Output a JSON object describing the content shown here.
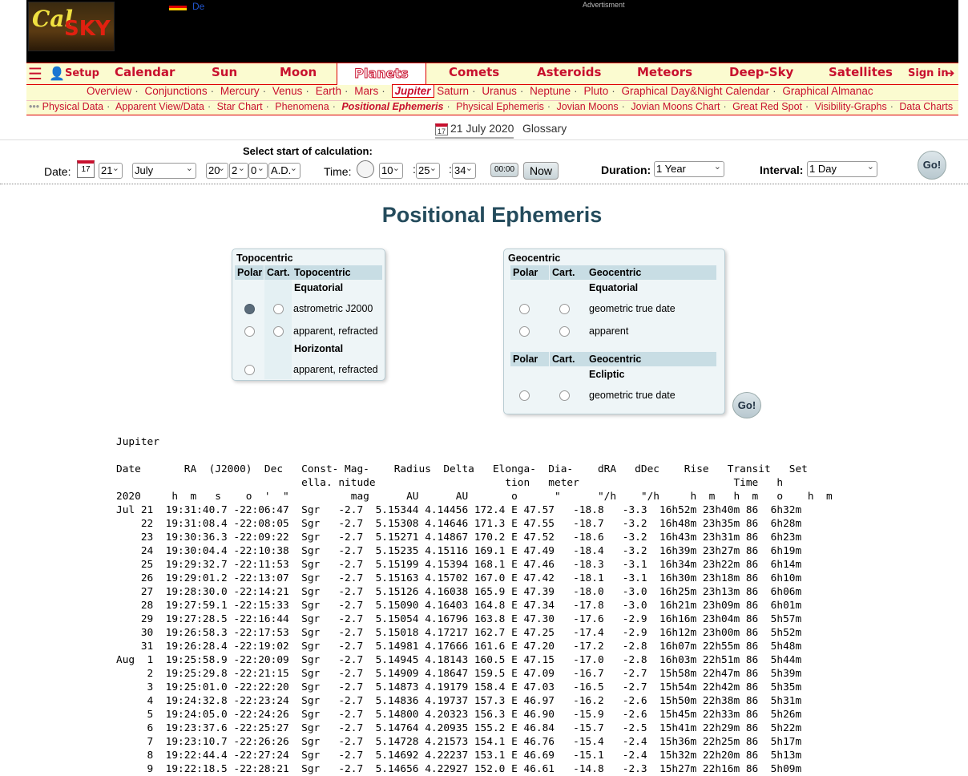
{
  "header": {
    "logo_text": [
      "Cal",
      "SKY"
    ],
    "lang": "De",
    "advertisement": "Advertisment"
  },
  "mainnav": {
    "setup": "Setup",
    "items": [
      "Calendar",
      "Sun",
      "Moon",
      "Planets",
      "Comets",
      "Asteroids",
      "Meteors",
      "Deep-Sky",
      "Satellites"
    ],
    "signin": "Sign in"
  },
  "subnav1": [
    "Overview",
    "Conjunctions",
    "Mercury",
    "Venus",
    "Earth",
    "Mars",
    "Jupiter",
    "Saturn",
    "Uranus",
    "Neptune",
    "Pluto",
    "Graphical Day&Night Calendar",
    "Graphical Almanac"
  ],
  "subnav2": [
    "Physical Data",
    "Apparent View/Data",
    "Star Chart",
    "Phenomena",
    "Positional Ephemeris",
    "Physical Ephemeris",
    "Jovian Moons",
    "Jovian Moons Chart",
    "Great Red Spot",
    "Visibility-Graphs",
    "Data Charts"
  ],
  "dateline": {
    "date": "21 July 2020",
    "glossary": "Glossary",
    "cal_icon_text": "17"
  },
  "form": {
    "heading": "Select start of calculation:",
    "date_label": "Date:",
    "day": "21",
    "month": "July",
    "century": "20",
    "decade": "2",
    "year_digit": "0",
    "era": "A.D.",
    "time_label": "Time:",
    "hour": "10",
    "minute": "25",
    "second": "34",
    "zero_btn": "00:00",
    "now_btn": "Now",
    "duration_label": "Duration:",
    "duration": "1 Year",
    "interval_label": "Interval:",
    "interval": "1 Day",
    "go": "Go!"
  },
  "page_title": "Positional Ephemeris",
  "topocentric": {
    "title": "Topocentric",
    "col_polar": "Polar",
    "col_cart": "Cart.",
    "col_head": "Topocentric",
    "sub1": "Equatorial",
    "opt1": "astrometric J2000",
    "opt2": "apparent, refracted",
    "sub2": "Horizontal",
    "opt3": "apparent, refracted"
  },
  "geocentric": {
    "title": "Geocentric",
    "col_polar": "Polar",
    "col_cart": "Cart.",
    "col_head": "Geocentric",
    "sub1": "Equatorial",
    "opt1": "geometric true date",
    "opt2": "apparent",
    "col_head2": "Geocentric",
    "sub2": "Ecliptic",
    "opt3": "geometric true date",
    "go": "Go!"
  },
  "ephemeris_text": "Jupiter\n\nDate       RA  (J2000)  Dec   Const- Mag-    Radius  Delta   Elonga-  Dia-    dRA   dDec    Rise   Transit   Set\n                              ella. nitude                     tion   meter                         Time   h\n2020     h  m   s    o  '  \"          mag      AU      AU       o      \"      \"/h    \"/h     h  m   h  m   o    h  m\nJul 21  19:31:40.7 -22:06:47  Sgr   -2.7  5.15344 4.14456 172.4 E 47.57   -18.8   -3.3  16h52m 23h40m 86  6h32m\n    22  19:31:08.4 -22:08:05  Sgr   -2.7  5.15308 4.14646 171.3 E 47.55   -18.7   -3.2  16h48m 23h35m 86  6h28m\n    23  19:30:36.3 -22:09:22  Sgr   -2.7  5.15271 4.14867 170.2 E 47.52   -18.6   -3.2  16h43m 23h31m 86  6h23m\n    24  19:30:04.4 -22:10:38  Sgr   -2.7  5.15235 4.15116 169.1 E 47.49   -18.4   -3.2  16h39m 23h27m 86  6h19m\n    25  19:29:32.7 -22:11:53  Sgr   -2.7  5.15199 4.15394 168.1 E 47.46   -18.3   -3.1  16h34m 23h22m 86  6h14m\n    26  19:29:01.2 -22:13:07  Sgr   -2.7  5.15163 4.15702 167.0 E 47.42   -18.1   -3.1  16h30m 23h18m 86  6h10m\n    27  19:28:30.0 -22:14:21  Sgr   -2.7  5.15126 4.16038 165.9 E 47.39   -18.0   -3.0  16h25m 23h13m 86  6h06m\n    28  19:27:59.1 -22:15:33  Sgr   -2.7  5.15090 4.16403 164.8 E 47.34   -17.8   -3.0  16h21m 23h09m 86  6h01m\n    29  19:27:28.5 -22:16:44  Sgr   -2.7  5.15054 4.16796 163.8 E 47.30   -17.6   -2.9  16h16m 23h04m 86  5h57m\n    30  19:26:58.3 -22:17:53  Sgr   -2.7  5.15018 4.17217 162.7 E 47.25   -17.4   -2.9  16h12m 23h00m 86  5h52m\n    31  19:26:28.4 -22:19:02  Sgr   -2.7  5.14981 4.17666 161.6 E 47.20   -17.2   -2.8  16h07m 22h55m 86  5h48m\nAug  1  19:25:58.9 -22:20:09  Sgr   -2.7  5.14945 4.18143 160.5 E 47.15   -17.0   -2.8  16h03m 22h51m 86  5h44m\n     2  19:25:29.8 -22:21:15  Sgr   -2.7  5.14909 4.18647 159.5 E 47.09   -16.7   -2.7  15h58m 22h47m 86  5h39m\n     3  19:25:01.0 -22:22:20  Sgr   -2.7  5.14873 4.19179 158.4 E 47.03   -16.5   -2.7  15h54m 22h42m 86  5h35m\n     4  19:24:32.8 -22:23:24  Sgr   -2.7  5.14836 4.19737 157.3 E 46.97   -16.2   -2.6  15h50m 22h38m 86  5h31m\n     5  19:24:05.0 -22:24:26  Sgr   -2.7  5.14800 4.20323 156.3 E 46.90   -15.9   -2.6  15h45m 22h33m 86  5h26m\n     6  19:23:37.6 -22:25:27  Sgr   -2.7  5.14764 4.20935 155.2 E 46.84   -15.7   -2.5  15h41m 22h29m 86  5h22m\n     7  19:23:10.7 -22:26:26  Sgr   -2.7  5.14728 4.21573 154.1 E 46.76   -15.4   -2.4  15h36m 22h25m 86  5h17m\n     8  19:22:44.4 -22:27:24  Sgr   -2.7  5.14692 4.22237 153.1 E 46.69   -15.1   -2.4  15h32m 22h20m 86  5h13m\n     9  19:22:18.5 -22:28:21  Sgr   -2.7  5.14656 4.22927 152.0 E 46.61   -14.8   -2.3  15h27m 22h16m 86  5h09m"
}
